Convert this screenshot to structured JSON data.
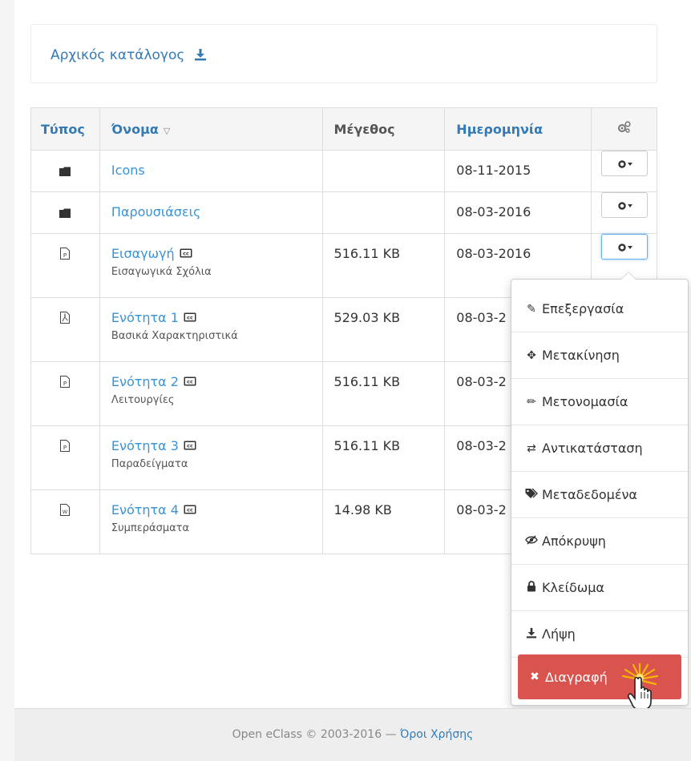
{
  "breadcrumb": {
    "label": "Αρχικός κατάλογος",
    "icon": "download-icon"
  },
  "table": {
    "headers": {
      "type": "Τύπος",
      "name": "Όνομα",
      "size": "Μέγεθος",
      "date": "Ημερομηνία",
      "actions_icon": "gears-icon"
    },
    "rows": [
      {
        "type_icon": "folder-icon",
        "name": "Icons",
        "description": "",
        "size": "",
        "date": "08-11-2015"
      },
      {
        "type_icon": "folder-icon",
        "name": "Παρουσιάσεις",
        "description": "",
        "size": "",
        "date": "08-03-2016"
      },
      {
        "type_icon": "powerpoint-file-icon",
        "name": "Εισαγωγή",
        "description": "Εισαγωγικά Σχόλια",
        "size": "516.11 KB",
        "date": "08-03-2016",
        "cc": true
      },
      {
        "type_icon": "pdf-file-icon",
        "name": "Ενότητα 1",
        "description": "Βασικά Χαρακτηριστικά",
        "size": "529.03 KB",
        "date": "08-03-2",
        "cc": true
      },
      {
        "type_icon": "powerpoint-file-icon",
        "name": "Ενότητα 2",
        "description": "Λειτουργίες",
        "size": "516.11 KB",
        "date": "08-03-2",
        "cc": true
      },
      {
        "type_icon": "powerpoint-file-icon",
        "name": "Ενότητα 3",
        "description": "Παραδείγματα",
        "size": "516.11 KB",
        "date": "08-03-2",
        "cc": true
      },
      {
        "type_icon": "word-file-icon",
        "name": "Ενότητα 4",
        "description": "Συμπεράσματα",
        "size": "14.98 KB",
        "date": "08-03-2",
        "cc": true
      }
    ]
  },
  "action_menu": {
    "items": [
      {
        "label": "Επεξεργασία",
        "icon": "edit-icon"
      },
      {
        "label": "Μετακίνηση",
        "icon": "move-icon"
      },
      {
        "label": "Μετονομασία",
        "icon": "pencil-icon"
      },
      {
        "label": "Αντικατάσταση",
        "icon": "exchange-icon"
      },
      {
        "label": "Μεταδεδομένα",
        "icon": "tags-icon"
      },
      {
        "label": "Απόκρυψη",
        "icon": "eye-slash-icon"
      },
      {
        "label": "Κλείδωμα",
        "icon": "lock-icon"
      },
      {
        "label": "Λήψη",
        "icon": "download-icon"
      }
    ],
    "delete": {
      "label": "Διαγραφή",
      "icon": "times-icon"
    }
  },
  "footer": {
    "text": "Open eClass © 2003-2016 —",
    "link": "Όροι Χρήσης"
  },
  "colors": {
    "link": "#337ab7",
    "delete": "#d9534f",
    "header_bg": "#f5f5f5",
    "cursor_burst": "#f5b800"
  }
}
